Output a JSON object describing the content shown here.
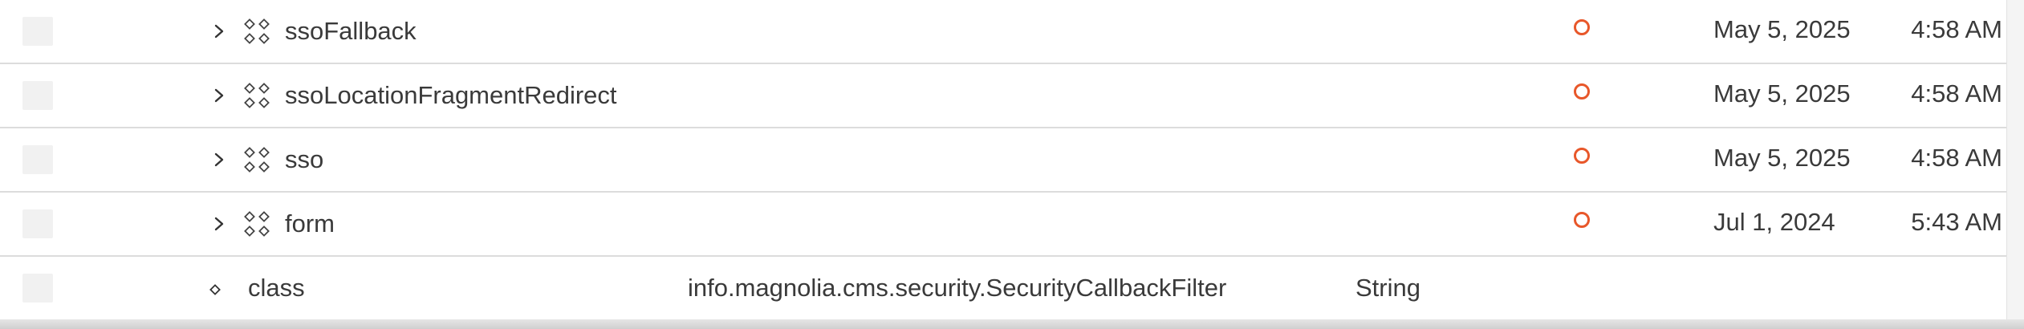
{
  "rows": [
    {
      "kind": "node",
      "name": "ssoFallback",
      "value": "",
      "type": "",
      "date": "May 5, 2025",
      "time": "4:58 AM"
    },
    {
      "kind": "node",
      "name": "ssoLocationFragmentRedirect",
      "value": "",
      "type": "",
      "date": "May 5, 2025",
      "time": "4:58 AM"
    },
    {
      "kind": "node",
      "name": "sso",
      "value": "",
      "type": "",
      "date": "May 5, 2025",
      "time": "4:58 AM"
    },
    {
      "kind": "node",
      "name": "form",
      "value": "",
      "type": "",
      "date": "Jul 1, 2024",
      "time": "5:43 AM"
    },
    {
      "kind": "property",
      "name": "class",
      "value": "info.magnolia.cms.security.SecurityCallbackFilter",
      "type": "String",
      "date": "",
      "time": ""
    }
  ],
  "colors": {
    "status_modified": "#e8572a",
    "row_divider": "#dcdcdc",
    "checkbox_bg": "#f1f1f1",
    "text": "#3a3a3a"
  },
  "icons": {
    "expand": "chevron-right-icon",
    "node": "content-node-icon",
    "property": "property-diamond-icon",
    "status": "status-modified-icon"
  }
}
